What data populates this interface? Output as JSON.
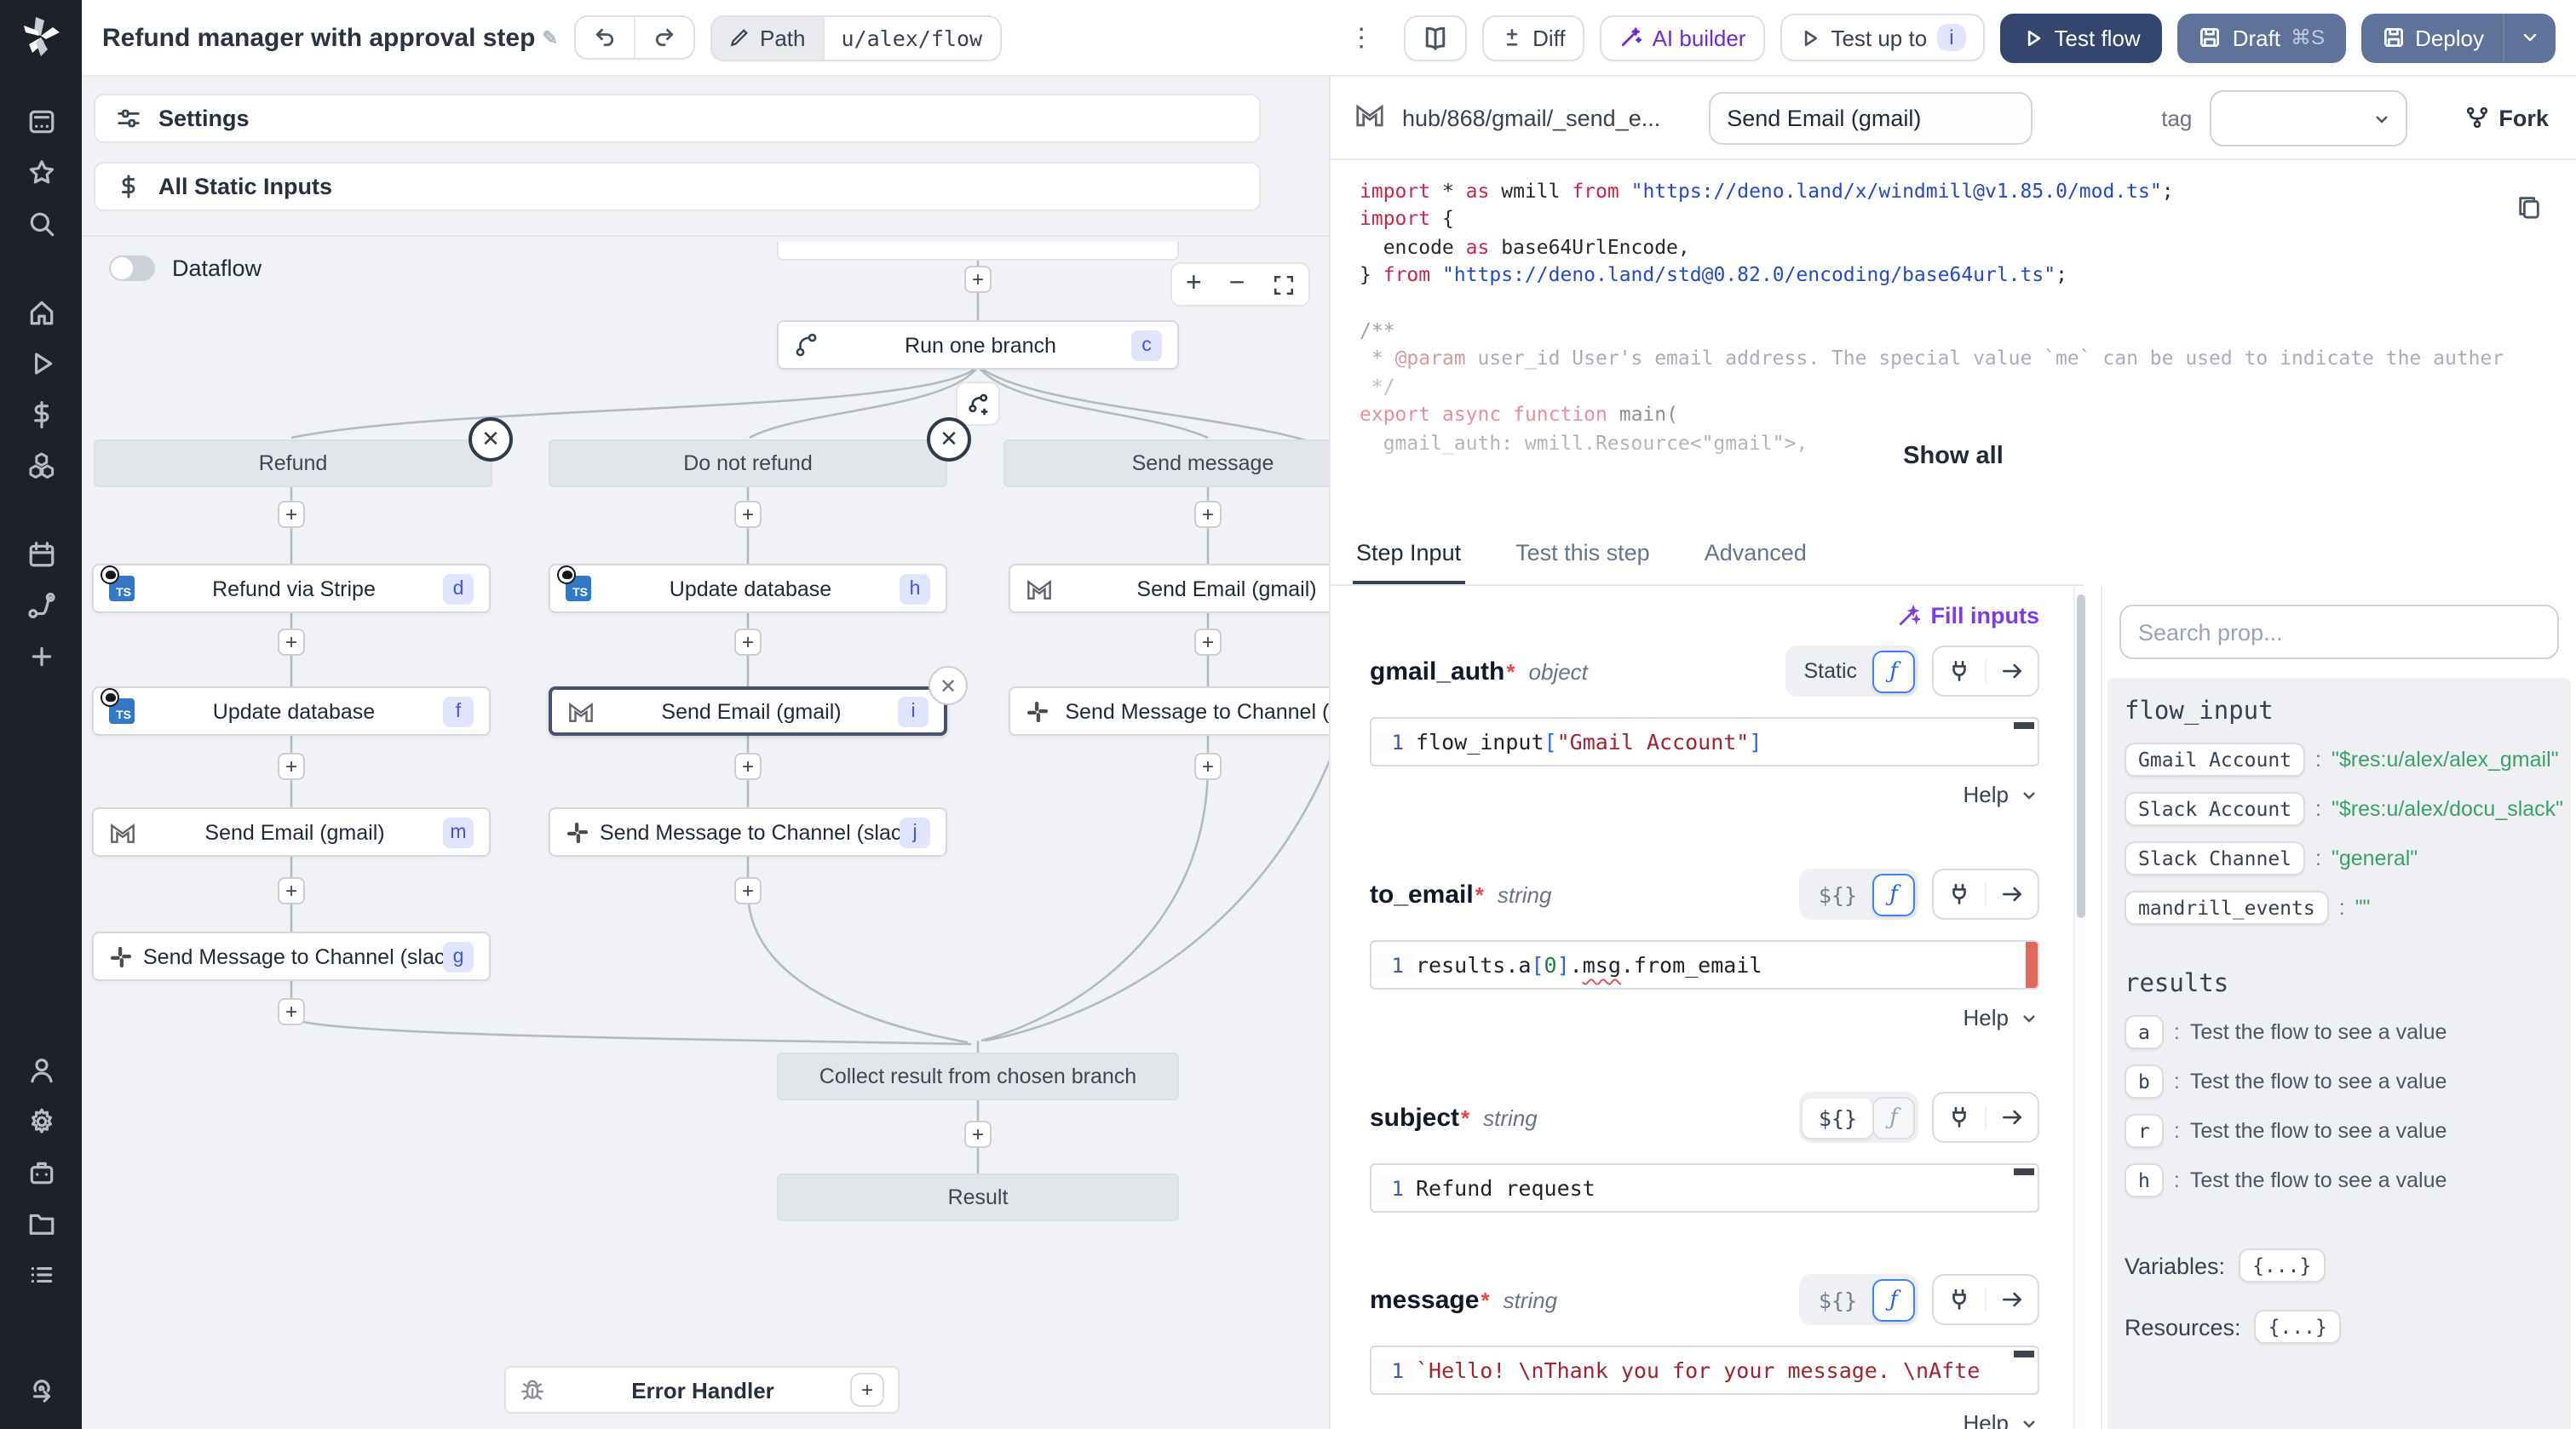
{
  "topbar": {
    "title": "Refund manager with approval step",
    "path_label": "Path",
    "path_value": "u/alex/flow",
    "diff_label": "Diff",
    "ai_builder_label": "AI builder",
    "test_up_to_label": "Test up to",
    "test_up_to_badge": "i",
    "test_flow_label": "Test flow",
    "draft_label": "Draft",
    "draft_shortcut": "⌘S",
    "deploy_label": "Deploy"
  },
  "sidebar": {
    "icons": [
      "workspace",
      "star",
      "search",
      "home",
      "runs",
      "variables",
      "resources",
      "schedules",
      "routes",
      "add",
      "user",
      "settings",
      "workers",
      "folders",
      "logs",
      "help-arrow"
    ]
  },
  "left_panel": {
    "settings_label": "Settings",
    "static_inputs_label": "All Static Inputs",
    "dataflow_label": "Dataflow"
  },
  "graph": {
    "run_one_branch": {
      "label": "Run one branch",
      "badge": "c"
    },
    "branch_headers": [
      {
        "label": "Refund"
      },
      {
        "label": "Do not refund"
      },
      {
        "label": "Send message"
      }
    ],
    "nodes": {
      "refund_via_stripe": {
        "label": "Refund via Stripe",
        "badge": "d"
      },
      "update_database_h": {
        "label": "Update database",
        "badge": "h"
      },
      "send_email_top_right": {
        "label": "Send Email (gmail)"
      },
      "update_database_f": {
        "label": "Update database",
        "badge": "f"
      },
      "send_email_selected": {
        "label": "Send Email (gmail)",
        "badge": "i"
      },
      "send_slack_right": {
        "label": "Send Message to Channel (slack)"
      },
      "send_email_m": {
        "label": "Send Email (gmail)",
        "badge": "m"
      },
      "send_slack_j": {
        "label": "Send Message to Channel (slack)",
        "badge": "j"
      },
      "send_slack_g": {
        "label": "Send Message to Channel (slack)",
        "badge": "g"
      }
    },
    "collect_label": "Collect result from chosen branch",
    "result_label": "Result",
    "error_handler_label": "Error Handler"
  },
  "step_panel": {
    "hub_path": "hub/868/gmail/_send_e...",
    "summary": "Send Email (gmail)",
    "tag_label": "tag",
    "fork_label": "Fork",
    "show_all_label": "Show all",
    "tabs": [
      {
        "label": "Step Input",
        "active": true
      },
      {
        "label": "Test this step",
        "active": false
      },
      {
        "label": "Advanced",
        "active": false
      }
    ],
    "fill_inputs_label": "Fill inputs",
    "code_lines": [
      [
        {
          "t": "import",
          "c": "kw"
        },
        {
          "t": " * ",
          "c": "pl"
        },
        {
          "t": "as",
          "c": "kw"
        },
        {
          "t": " wmill ",
          "c": "pl"
        },
        {
          "t": "from",
          "c": "kw"
        },
        {
          "t": " ",
          "c": "pl"
        },
        {
          "t": "\"https://deno.land/x/windmill@v1.85.0/mod.ts\"",
          "c": "str"
        },
        {
          "t": ";",
          "c": "pl"
        }
      ],
      [
        {
          "t": "import",
          "c": "kw"
        },
        {
          "t": " {",
          "c": "pl"
        }
      ],
      [
        {
          "t": "  encode ",
          "c": "pl"
        },
        {
          "t": "as",
          "c": "kw"
        },
        {
          "t": " base64UrlEncode,",
          "c": "pl"
        }
      ],
      [
        {
          "t": "} ",
          "c": "pl"
        },
        {
          "t": "from",
          "c": "kw"
        },
        {
          "t": " ",
          "c": "pl"
        },
        {
          "t": "\"https://deno.land/std@0.82.0/encoding/base64url.ts\"",
          "c": "str"
        },
        {
          "t": ";",
          "c": "pl"
        }
      ],
      [],
      [
        {
          "t": "/**",
          "c": "cm"
        }
      ],
      [
        {
          "t": " * ",
          "c": "cm"
        },
        {
          "t": "@param",
          "c": "at"
        },
        {
          "t": " user_id User's email address. The special value `me` can be used to indicate the auther",
          "c": "cm"
        }
      ],
      [
        {
          "t": " */",
          "c": "cm"
        }
      ],
      [
        {
          "t": "export",
          "c": "kw"
        },
        {
          "t": " ",
          "c": "pl"
        },
        {
          "t": "async",
          "c": "kw"
        },
        {
          "t": " ",
          "c": "pl"
        },
        {
          "t": "function",
          "c": "kw"
        },
        {
          "t": " main(",
          "c": "pl"
        }
      ],
      [
        {
          "t": "  gmail_auth: wmill.Resource<\"gmail\">,",
          "c": "pl"
        }
      ]
    ],
    "fields": [
      {
        "name": "gmail_auth",
        "required": "*",
        "type": "object",
        "toggle_left": "Static",
        "line_no": "1",
        "help_label": "Help",
        "code": [
          {
            "t": "flow_input",
            "c": "pl"
          },
          {
            "t": "[",
            "c": "br"
          },
          {
            "t": "\"Gmail Account\"",
            "c": "rs"
          },
          {
            "t": "]",
            "c": "br"
          }
        ]
      },
      {
        "name": "to_email",
        "required": "*",
        "type": "string",
        "toggle_left": "${}",
        "line_no": "1",
        "help_label": "Help",
        "code": [
          {
            "t": "results.a",
            "c": "pl"
          },
          {
            "t": "[",
            "c": "br"
          },
          {
            "t": "0",
            "c": "num"
          },
          {
            "t": "]",
            "c": "br"
          },
          {
            "t": ".",
            "c": "pl"
          },
          {
            "t": "msg",
            "c": "pl",
            "sq": true
          },
          {
            "t": ".from_email",
            "c": "pl"
          }
        ]
      },
      {
        "name": "subject",
        "required": "*",
        "type": "string",
        "toggle_left": "${}",
        "line_no": "1",
        "help_label": "",
        "code": [
          {
            "t": "Refund request",
            "c": "pl"
          }
        ]
      },
      {
        "name": "message",
        "required": "*",
        "type": "string",
        "toggle_left": "${}",
        "line_no": "1",
        "help_label": "Help",
        "code": [
          {
            "t": "`Hello! \\nThank you for your message. \\nAfte",
            "c": "rs"
          }
        ]
      }
    ]
  },
  "prop_panel": {
    "search_placeholder": "Search prop...",
    "flow_input_title": "flow_input",
    "flow_inputs": [
      {
        "key": "Gmail Account",
        "value": "\"$res:u/alex/alex_gmail\""
      },
      {
        "key": "Slack Account",
        "value": "\"$res:u/alex/docu_slack\""
      },
      {
        "key": "Slack Channel",
        "value": "\"general\""
      },
      {
        "key": "mandrill_events",
        "value": "\"\""
      }
    ],
    "results_title": "results",
    "results": [
      {
        "key": "a",
        "value": "Test the flow to see a value"
      },
      {
        "key": "b",
        "value": "Test the flow to see a value"
      },
      {
        "key": "r",
        "value": "Test the flow to see a value"
      },
      {
        "key": "h",
        "value": "Test the flow to see a value"
      }
    ],
    "variables_label": "Variables:",
    "variables_value": "{...}",
    "resources_label": "Resources:",
    "resources_value": "{...}"
  },
  "colors": {
    "accent_indigo": "#4552d9",
    "badge_bg": "#e0e4fc",
    "purple": "#6d28d9",
    "test_flow_bg": "#35466e",
    "deploy_bg": "#5f7299",
    "value_green": "#38a169",
    "error_red": "#e0695e"
  }
}
